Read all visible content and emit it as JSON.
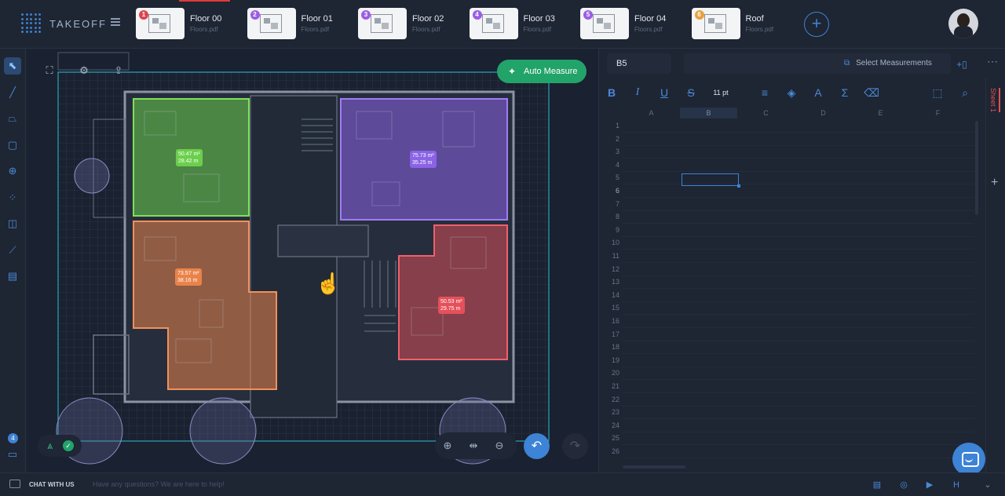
{
  "app": {
    "name": "TAKEOFF"
  },
  "tabs": [
    {
      "num": "1",
      "name": "Floor 00",
      "file": "Floors.pdf",
      "badge_color": "#e0444e",
      "active": true
    },
    {
      "num": "2",
      "name": "Floor 01",
      "file": "Floors.pdf",
      "badge_color": "#9b5de5"
    },
    {
      "num": "3",
      "name": "Floor 02",
      "file": "Floors.pdf",
      "badge_color": "#9b5de5"
    },
    {
      "num": "4",
      "name": "Floor 03",
      "file": "Floors.pdf",
      "badge_color": "#9b5de5"
    },
    {
      "num": "5",
      "name": "Floor 04",
      "file": "Floors.pdf",
      "badge_color": "#9b5de5"
    },
    {
      "num": "6",
      "name": "Roof",
      "file": "Floors.pdf",
      "badge_color": "#e6a23c"
    }
  ],
  "add_tab_label": "+",
  "tools": [
    {
      "name": "select-tool",
      "glyph": "⬉"
    },
    {
      "name": "line-tool",
      "glyph": "╱"
    },
    {
      "name": "polygon-tool",
      "glyph": "⏢"
    },
    {
      "name": "rectangle-tool",
      "glyph": "▢"
    },
    {
      "name": "search-area-tool",
      "glyph": "⊕"
    },
    {
      "name": "count-tool",
      "glyph": "⁘"
    },
    {
      "name": "note-tool",
      "glyph": "◫"
    },
    {
      "name": "ruler-tool",
      "glyph": "⟋"
    },
    {
      "name": "notes-book-tool",
      "glyph": "▤"
    }
  ],
  "left_notification_count": "4",
  "canvas": {
    "auto_measure_label": "Auto Measure",
    "areas": [
      {
        "name": "green-room",
        "color": "#6ccf4c",
        "area": "50.47 m²",
        "perimeter": "28.42 m"
      },
      {
        "name": "purple-room",
        "color": "#8a63e6",
        "area": "75.73 m²",
        "perimeter": "35.25 m"
      },
      {
        "name": "orange-room",
        "color": "#e9834a",
        "area": "73.57 m²",
        "perimeter": "38.16 m"
      },
      {
        "name": "red-room",
        "color": "#e5505a",
        "area": "50.53 m²",
        "perimeter": "29.75 m"
      }
    ]
  },
  "sheet": {
    "cell_ref": "B5",
    "select_measurements": "Select Measurements",
    "font_size": "11 pt",
    "columns": [
      "A",
      "B",
      "C",
      "D",
      "E",
      "F"
    ],
    "rows": [
      "1",
      "2",
      "3",
      "4",
      "5",
      "6",
      "7",
      "8",
      "9",
      "10",
      "11",
      "12",
      "13",
      "14",
      "15",
      "16",
      "17",
      "18",
      "19",
      "20",
      "21",
      "22",
      "23",
      "24",
      "25",
      "26"
    ],
    "sheet_tab": "Sheet 1"
  },
  "bottom": {
    "chat_label": "CHAT WITH US",
    "chat_help": "Have any questions? We are here to help!"
  }
}
